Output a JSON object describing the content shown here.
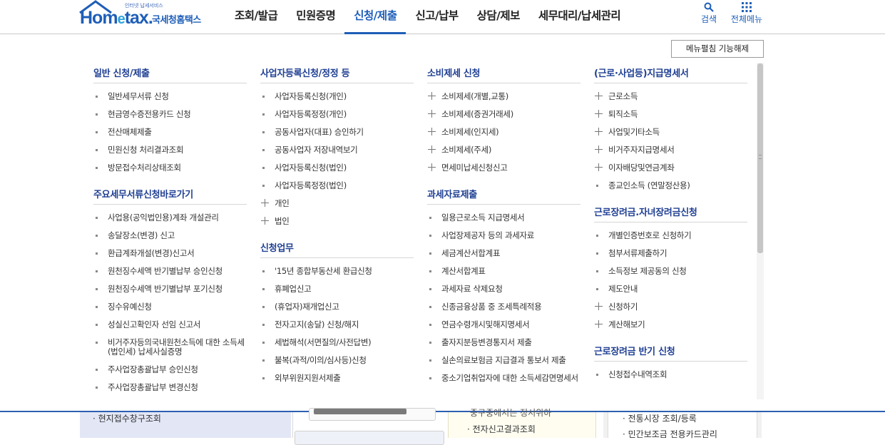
{
  "header": {
    "logo_tag": "인터넷 납세서비스",
    "logo_word_1": "Hom",
    "logo_word_e": "e",
    "logo_word_2": "tax",
    "logo_dot": ".",
    "logo_kr": "국세청홈택스",
    "nav": [
      {
        "label": "조회/발급",
        "active": false
      },
      {
        "label": "민원증명",
        "active": false
      },
      {
        "label": "신청/제출",
        "active": true
      },
      {
        "label": "신고/납부",
        "active": false
      },
      {
        "label": "상담/제보",
        "active": false
      },
      {
        "label": "세무대리/납세관리",
        "active": false
      }
    ],
    "search_label": "검색",
    "all_menu_label": "전체메뉴"
  },
  "panel": {
    "release_button": "메뉴펼침 기능해제",
    "columns": [
      {
        "groups": [
          {
            "title": "일반 신청/제출",
            "items": [
              {
                "label": "일반세무서류 신청",
                "marker": "dot"
              },
              {
                "label": "현금영수증전용카드 신청",
                "marker": "dot"
              },
              {
                "label": "전산매체제출",
                "marker": "dot"
              },
              {
                "label": "민원신청 처리결과조회",
                "marker": "dot"
              },
              {
                "label": "방문접수처리상태조회",
                "marker": "dot"
              }
            ]
          },
          {
            "title": "주요세무서류신청바로가기",
            "items": [
              {
                "label": "사업용(공익법인용)계좌 개설관리",
                "marker": "dot"
              },
              {
                "label": "송달장소(변경) 신고",
                "marker": "dot"
              },
              {
                "label": "환급계좌개설(변경)신고서",
                "marker": "dot"
              },
              {
                "label": "원천징수세액 반기별납부 승인신청",
                "marker": "dot"
              },
              {
                "label": "원천징수세액 반기별납부 포기신청",
                "marker": "dot"
              },
              {
                "label": "징수유예신청",
                "marker": "dot"
              },
              {
                "label": "성실신고확인자 선임 신고서",
                "marker": "dot"
              },
              {
                "label": "비거주자등의국내원천소득에 대한 소득세(법인세) 납세사실증명",
                "marker": "dot"
              },
              {
                "label": "주사업장총괄납부 승인신청",
                "marker": "dot"
              },
              {
                "label": "주사업장총괄납부 변경신청",
                "marker": "dot"
              }
            ]
          }
        ]
      },
      {
        "groups": [
          {
            "title": "사업자등록신청/정정 등",
            "items": [
              {
                "label": "사업자등록신청(개인)",
                "marker": "dot"
              },
              {
                "label": "사업자등록정정(개인)",
                "marker": "dot"
              },
              {
                "label": "공동사업자(대표) 승인하기",
                "marker": "dot"
              },
              {
                "label": "공동사업자 저장내역보기",
                "marker": "dot"
              },
              {
                "label": "사업자등록신청(법인)",
                "marker": "dot"
              },
              {
                "label": "사업자등록정정(법인)",
                "marker": "dot"
              },
              {
                "label": "개인",
                "marker": "plus"
              },
              {
                "label": "법인",
                "marker": "plus"
              }
            ]
          },
          {
            "title": "신청업무",
            "items": [
              {
                "label": "'15년 종합부동산세 환급신청",
                "marker": "dot"
              },
              {
                "label": "휴폐업신고",
                "marker": "dot"
              },
              {
                "label": "(휴업자)재개업신고",
                "marker": "dot"
              },
              {
                "label": "전자고지(송달) 신청/해지",
                "marker": "dot"
              },
              {
                "label": "세법해석(서면질의/사전답변)",
                "marker": "dot"
              },
              {
                "label": "불복(과적/이의/심사등)신청",
                "marker": "dot"
              },
              {
                "label": "외부위원지원서제출",
                "marker": "dot"
              }
            ]
          }
        ]
      },
      {
        "groups": [
          {
            "title": "소비제세 신청",
            "items": [
              {
                "label": "소비제세(개별,교통)",
                "marker": "plus"
              },
              {
                "label": "소비제세(증권거래세)",
                "marker": "plus"
              },
              {
                "label": "소비제세(인지세)",
                "marker": "plus"
              },
              {
                "label": "소비제세(주세)",
                "marker": "plus"
              },
              {
                "label": "면세미납세신청신고",
                "marker": "plus"
              }
            ]
          },
          {
            "title": "과세자료제출",
            "items": [
              {
                "label": "일용근로소득 지급명세서",
                "marker": "dot"
              },
              {
                "label": "사업장제공자 등의 과세자료",
                "marker": "dot"
              },
              {
                "label": "세금계산서합계표",
                "marker": "dot"
              },
              {
                "label": "계산서합계표",
                "marker": "dot"
              },
              {
                "label": "과세자료 삭제요청",
                "marker": "dot"
              },
              {
                "label": "신종금융상품 중 조세특례적용",
                "marker": "dot"
              },
              {
                "label": "연금수령개시및해지명세서",
                "marker": "dot"
              },
              {
                "label": "출자지분등변경통지서 제출",
                "marker": "dot"
              },
              {
                "label": "실손의료보험금 지급결과 통보서 제출",
                "marker": "dot"
              },
              {
                "label": "중소기업취업자에 대한 소득세감면명세서",
                "marker": "dot"
              }
            ]
          }
        ]
      },
      {
        "groups": [
          {
            "title": "(근로·사업등)지급명세서",
            "items": [
              {
                "label": "근로소득",
                "marker": "plus"
              },
              {
                "label": "퇴직소득",
                "marker": "plus"
              },
              {
                "label": "사업및기타소득",
                "marker": "plus"
              },
              {
                "label": "비거주자지급명세서",
                "marker": "plus"
              },
              {
                "label": "이자배당및연금계좌",
                "marker": "plus"
              },
              {
                "label": "종교인소득 (연말정산용)",
                "marker": "dot"
              }
            ]
          },
          {
            "title": "근로장려금.자녀장려금신청",
            "items": [
              {
                "label": "개별인증번호로 신청하기",
                "marker": "dot"
              },
              {
                "label": "첨부서류제출하기",
                "marker": "dot"
              },
              {
                "label": "소득정보 제공동의 신청",
                "marker": "dot"
              },
              {
                "label": "제도안내",
                "marker": "dot"
              },
              {
                "label": "신청하기",
                "marker": "plus"
              },
              {
                "label": "계산해보기",
                "marker": "plus"
              }
            ]
          },
          {
            "title": "근로장려금 반기 신청",
            "items": [
              {
                "label": "신청접수내역조회",
                "marker": "dot"
              }
            ]
          }
        ]
      }
    ]
  },
  "background": {
    "col1_text": "· 현지접수창구조회",
    "col3_top": "· 전자신고결과조회",
    "col3_partial": "중구중에서는 정서위하",
    "col4_text_1": "· 전통시장 조회/등록",
    "col4_text_2": "· 민간보조금 전용카드관리"
  },
  "colors": {
    "brand_blue": "#1e5eb8",
    "group_title": "#1f3f93",
    "divider_blue": "#2d5fb2"
  }
}
